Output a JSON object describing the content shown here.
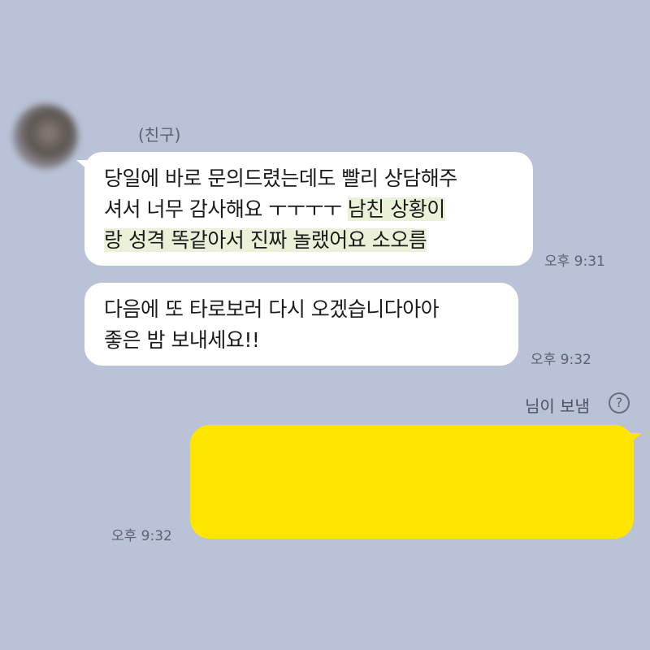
{
  "chat": {
    "sender_name": "(친구)",
    "messages": [
      {
        "lines": [
          [
            "당일에 바로 문의드렸는데도 빨리 상담해주"
          ],
          [
            "셔서 너무 감사해요 ㅜㅜㅜㅜ ",
            "남친 상황이"
          ],
          [
            "랑 성격 똑같아서 진짜 놀랬어요 소오름"
          ]
        ],
        "time": "오후 9:31"
      },
      {
        "lines": [
          [
            "다음에 또 타로보러 다시 오겠습니다아아"
          ],
          [
            "좋은 밤 보내세요!!"
          ]
        ],
        "time": "오후 9:32"
      }
    ],
    "read_status": "님이 보냄",
    "help_icon": "question-circle-icon",
    "my_message": {
      "time": "오후 9:32",
      "bubble_color": "#ffe500"
    }
  }
}
